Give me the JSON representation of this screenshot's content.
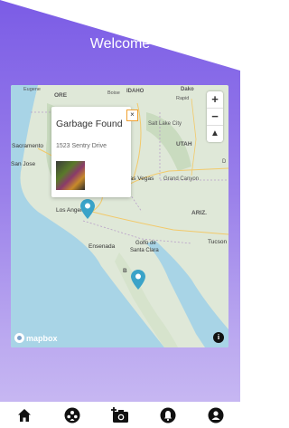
{
  "header": {
    "title": "Welcome"
  },
  "map": {
    "labels": {
      "ore": "ORE",
      "idaho": "IDAHO",
      "boise": "Boise",
      "eugene": "Eugene",
      "dakota": "Dako",
      "rapid_city": "Rapid",
      "utah": "UTAH",
      "salt_lake": "Salt Lake City",
      "sacramento": "Sacramento",
      "san_jose": "San Jose",
      "las_vegas": "Las Vegas",
      "grand_canyon": "Grand Canyon",
      "denver_edge": "D",
      "los_angeles": "Los Angeles",
      "ariz": "ARIZ.",
      "ensenada": "Ensenada",
      "golfo": "Golfo de",
      "santa_clara": "Santa Clara",
      "tucson": "Tucson",
      "baja": "B"
    },
    "popup": {
      "title": "Garbage Found",
      "address": "1523 Sentry Drive",
      "close": "×"
    },
    "zoom_in": "+",
    "zoom_out": "−",
    "compass": "▲",
    "brand": "mapbox",
    "info": "i"
  },
  "colors": {
    "gradient_top": "#7b5ce6",
    "gradient_bottom": "#cbbcf3",
    "pin": "#3aa3c8",
    "water": "#a8d4e6",
    "land": "#dfe8d8"
  },
  "tabbar": {
    "items": [
      "home-icon",
      "community-icon",
      "add-photo-icon",
      "notifications-icon",
      "profile-icon"
    ]
  }
}
